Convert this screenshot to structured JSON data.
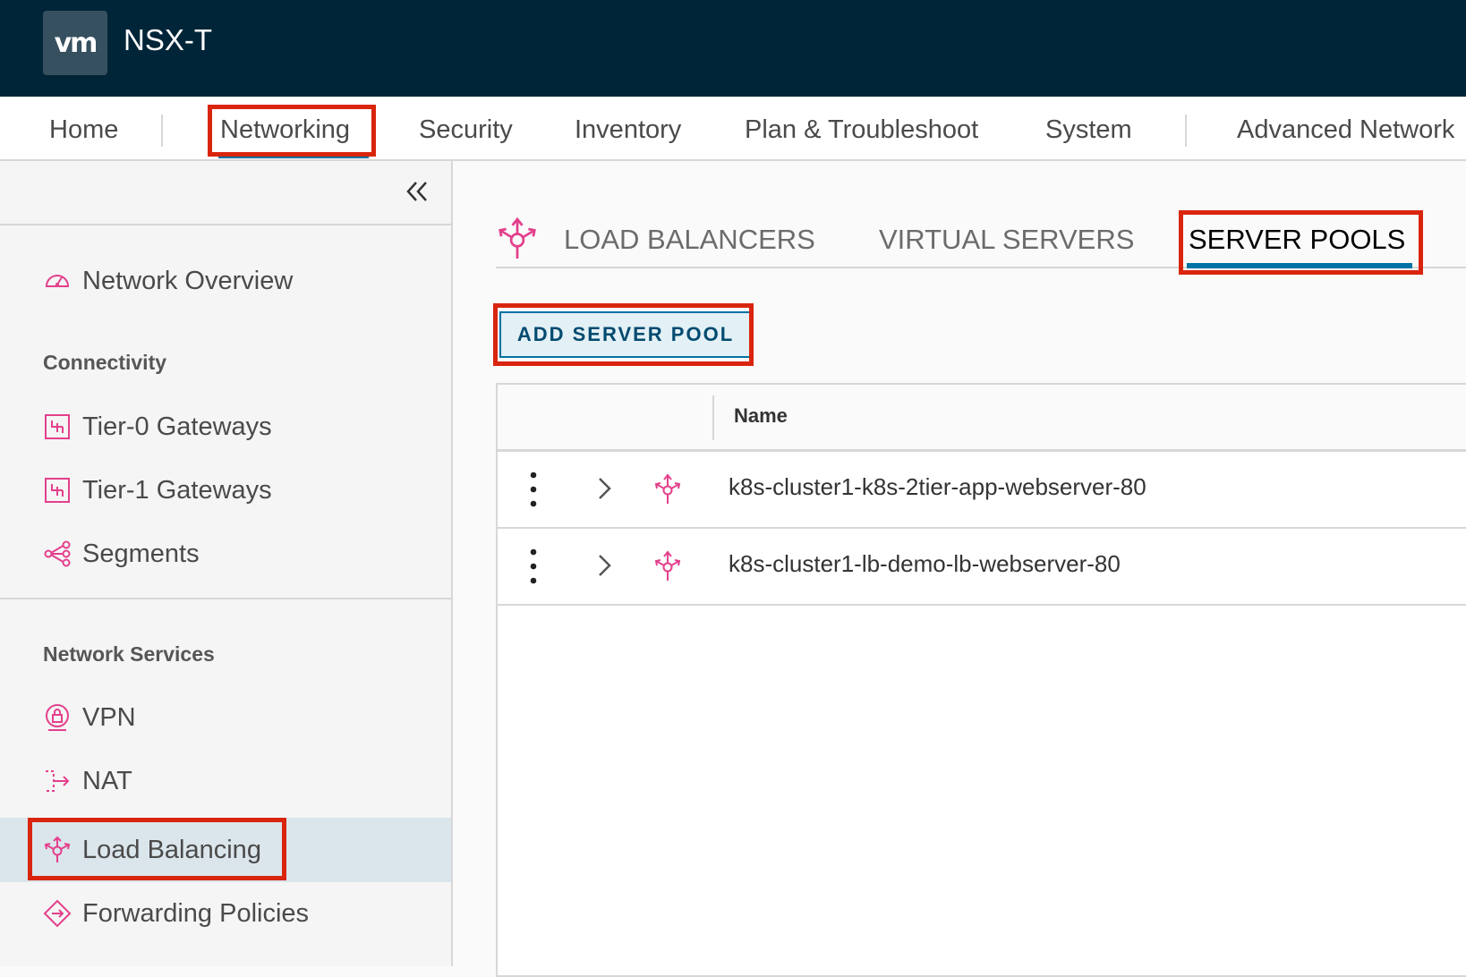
{
  "header": {
    "logo": "vm",
    "title": "NSX-T"
  },
  "topnav": {
    "items": [
      "Home",
      "Networking",
      "Security",
      "Inventory",
      "Plan & Troubleshoot",
      "System",
      "Advanced Network"
    ],
    "active": "Networking"
  },
  "sidebar": {
    "collapse_icon": "double-chevron-left-icon",
    "overview": {
      "label": "Network Overview",
      "icon": "dashboard-icon"
    },
    "connectivity_heading": "Connectivity",
    "connectivity": [
      {
        "label": "Tier-0 Gateways",
        "icon": "gateway-icon"
      },
      {
        "label": "Tier-1 Gateways",
        "icon": "gateway-icon"
      },
      {
        "label": "Segments",
        "icon": "segments-icon"
      }
    ],
    "services_heading": "Network Services",
    "services": [
      {
        "label": "VPN",
        "icon": "vpn-lock-icon"
      },
      {
        "label": "NAT",
        "icon": "nat-icon"
      },
      {
        "label": "Load Balancing",
        "icon": "load-balancer-icon"
      },
      {
        "label": "Forwarding Policies",
        "icon": "forwarding-icon"
      }
    ],
    "active": "Load Balancing"
  },
  "main": {
    "tabs": [
      "LOAD BALANCERS",
      "VIRTUAL SERVERS",
      "SERVER POOLS"
    ],
    "active_tab": "SERVER POOLS",
    "add_button": "ADD SERVER POOL",
    "grid": {
      "column_name": "Name",
      "rows": [
        {
          "name": "k8s-cluster1-k8s-2tier-app-webserver-80"
        },
        {
          "name": "k8s-cluster1-lb-demo-lb-webserver-80"
        }
      ]
    }
  },
  "colors": {
    "header_bg": "#002538",
    "accent": "#0072a3",
    "highlight": "#d9250d",
    "icon_pink": "#e3408c"
  }
}
